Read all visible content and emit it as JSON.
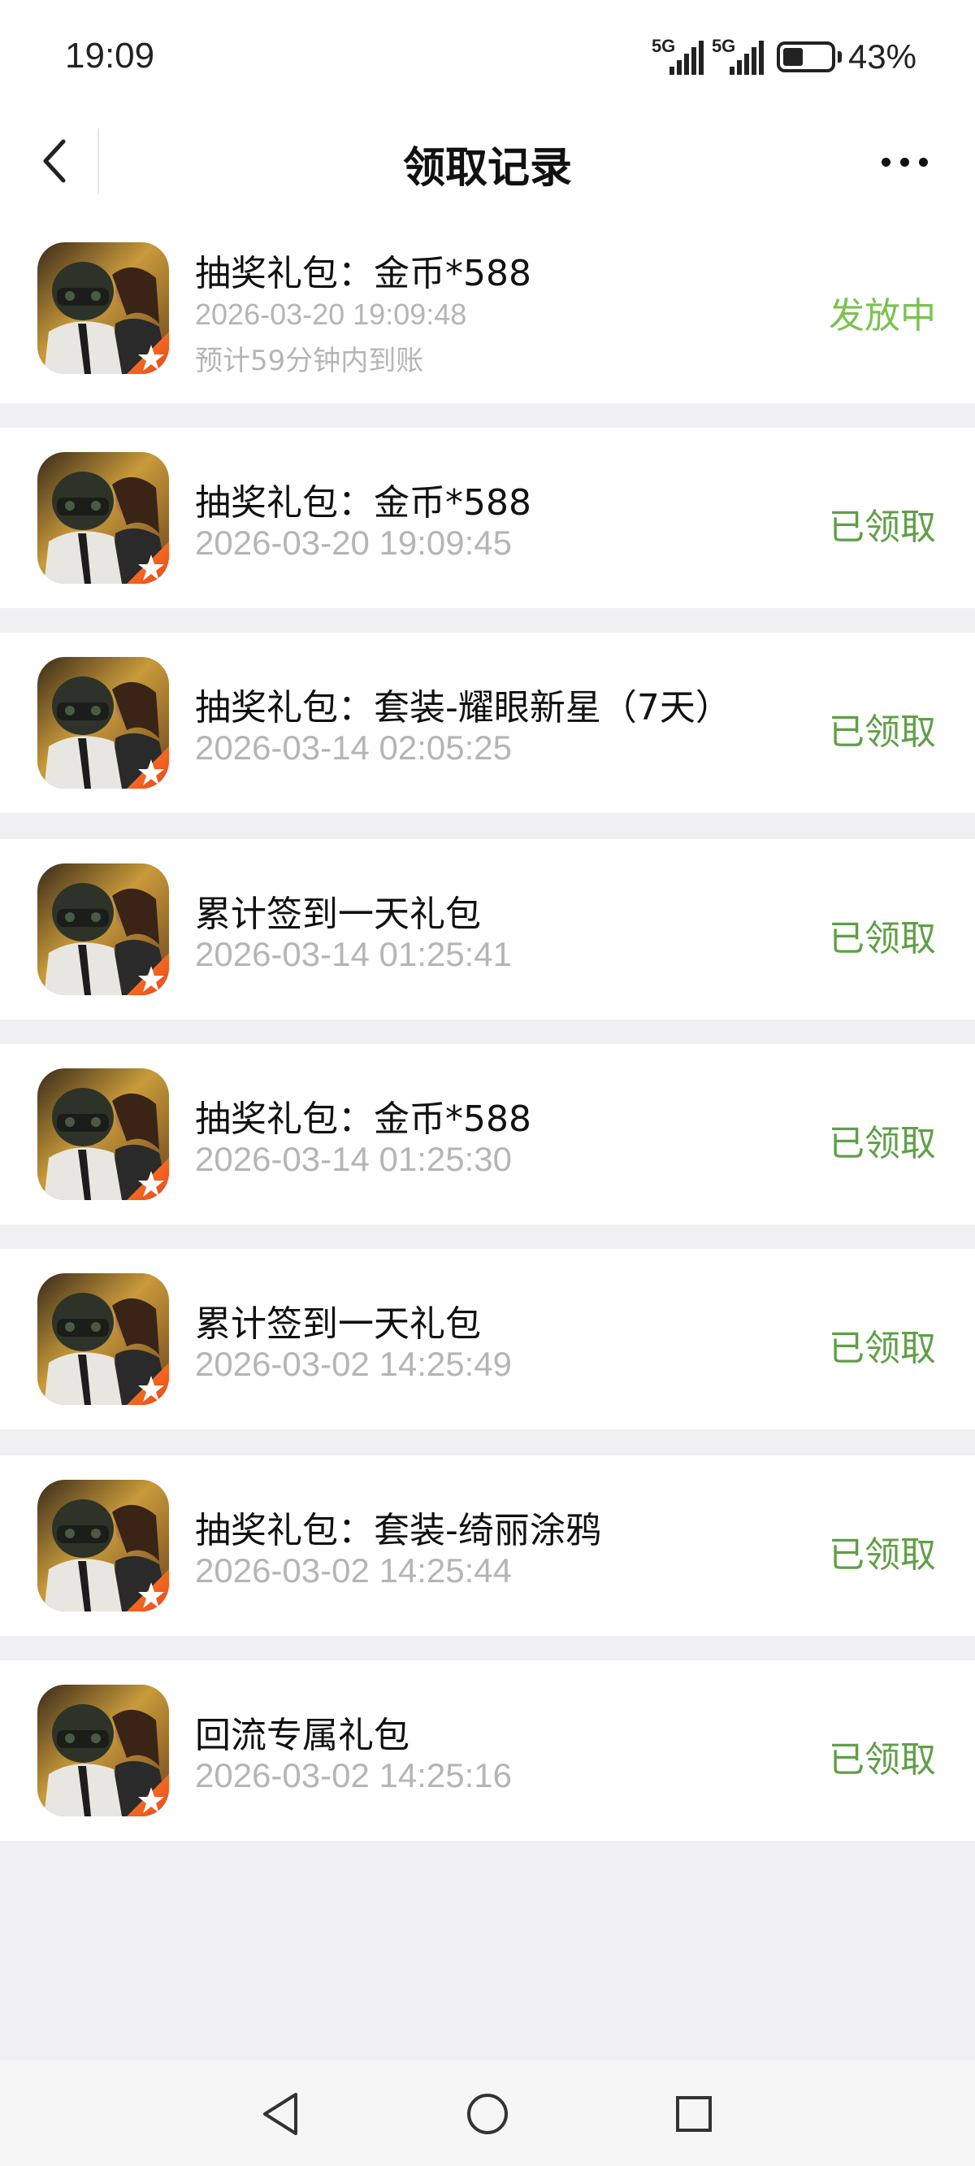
{
  "status_bar": {
    "time": "19:09",
    "signal_1_label": "5G",
    "signal_2_label": "5G",
    "battery_percent": "43%",
    "battery_level": 0.43
  },
  "nav": {
    "title": "领取记录",
    "back_icon": "chevron-left-icon",
    "more_icon": "more-dots-icon"
  },
  "records": [
    {
      "title": "抽奖礼包：金币*588",
      "time": "2026-03-20 19:09:48",
      "note": "预计59分钟内到账",
      "status": "发放中"
    },
    {
      "title": "抽奖礼包：金币*588",
      "time": "2026-03-20 19:09:45",
      "status": "已领取"
    },
    {
      "title": "抽奖礼包：套装-耀眼新星（7天）",
      "time": "2026-03-14 02:05:25",
      "status": "已领取"
    },
    {
      "title": "累计签到一天礼包",
      "time": "2026-03-14 01:25:41",
      "status": "已领取"
    },
    {
      "title": "抽奖礼包：金币*588",
      "time": "2026-03-14 01:25:30",
      "status": "已领取"
    },
    {
      "title": "累计签到一天礼包",
      "time": "2026-03-02 14:25:49",
      "status": "已领取"
    },
    {
      "title": "抽奖礼包：套装-绮丽涂鸦",
      "time": "2026-03-02 14:25:44",
      "status": "已领取"
    },
    {
      "title": "回流专属礼包",
      "time": "2026-03-02 14:25:16",
      "status": "已领取"
    }
  ],
  "colors": {
    "status_pending": "#7cc251",
    "status_done": "#5f9f46",
    "time_gray": "#b5b5b5",
    "page_bg": "#f0f0f2"
  },
  "system_nav": {
    "back_icon": "triangle-back-icon",
    "home_icon": "circle-home-icon",
    "recents_icon": "square-recents-icon"
  }
}
